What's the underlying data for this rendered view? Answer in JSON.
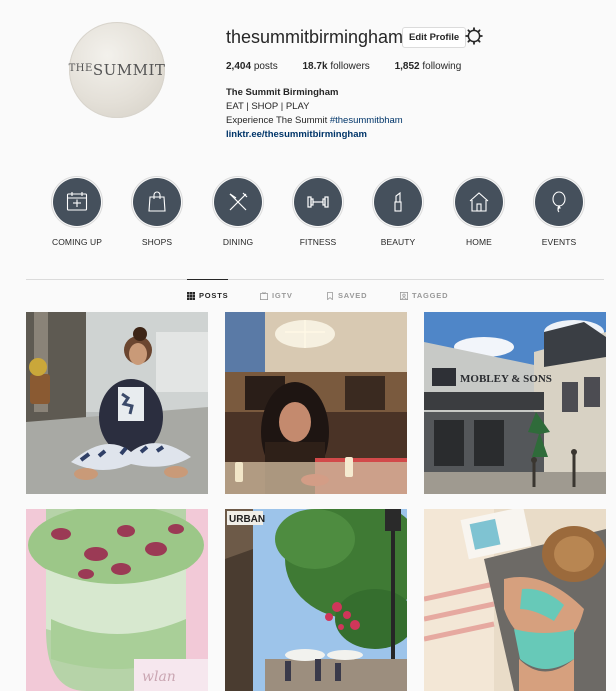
{
  "profile": {
    "username": "thesummitbirmingham",
    "edit_label": "Edit Profile",
    "avatar_text_small": "THE",
    "avatar_text_big": "SUMMIT",
    "stats": {
      "posts_count": "2,404",
      "posts_label": "posts",
      "followers_count": "18.7k",
      "followers_label": "followers",
      "following_count": "1,852",
      "following_label": "following"
    },
    "bio": {
      "name": "The Summit Birmingham",
      "line1": "EAT | SHOP | PLAY",
      "line2_prefix": "Experience The Summit ",
      "line2_tag": "#thesummitbham",
      "link": "linktr.ee/thesummitbirmingham"
    }
  },
  "highlights": [
    {
      "label": "COMING UP",
      "icon": "calendar-icon"
    },
    {
      "label": "SHOPS",
      "icon": "shopping-bag-icon"
    },
    {
      "label": "DINING",
      "icon": "fork-knife-icon"
    },
    {
      "label": "FITNESS",
      "icon": "dumbbell-icon"
    },
    {
      "label": "BEAUTY",
      "icon": "lipstick-icon"
    },
    {
      "label": "HOME",
      "icon": "house-icon"
    },
    {
      "label": "EVENTS",
      "icon": "balloon-icon"
    }
  ],
  "tabs": [
    {
      "label": "POSTS",
      "icon": "grid-icon",
      "active": true
    },
    {
      "label": "IGTV",
      "icon": "tv-icon",
      "active": false
    },
    {
      "label": "SAVED",
      "icon": "bookmark-icon",
      "active": false
    },
    {
      "label": "TAGGED",
      "icon": "tag-icon",
      "active": false
    }
  ],
  "posts": [
    {
      "subject": "yoga-woman-photo",
      "store_sign": ""
    },
    {
      "subject": "nail-salon-photo",
      "store_sign": ""
    },
    {
      "subject": "storefront-photo",
      "store_sign": "MOBLEY & SONS"
    },
    {
      "subject": "matcha-drink-photo",
      "store_sign": ""
    },
    {
      "subject": "street-trees-photo",
      "store_sign": "URBAN"
    },
    {
      "subject": "beach-swimsuit-photo",
      "store_sign": ""
    }
  ],
  "colors": {
    "highlight_fill": "#45505c",
    "link": "#003569",
    "divider": "#dbdbdb",
    "background": "#fafafa"
  }
}
